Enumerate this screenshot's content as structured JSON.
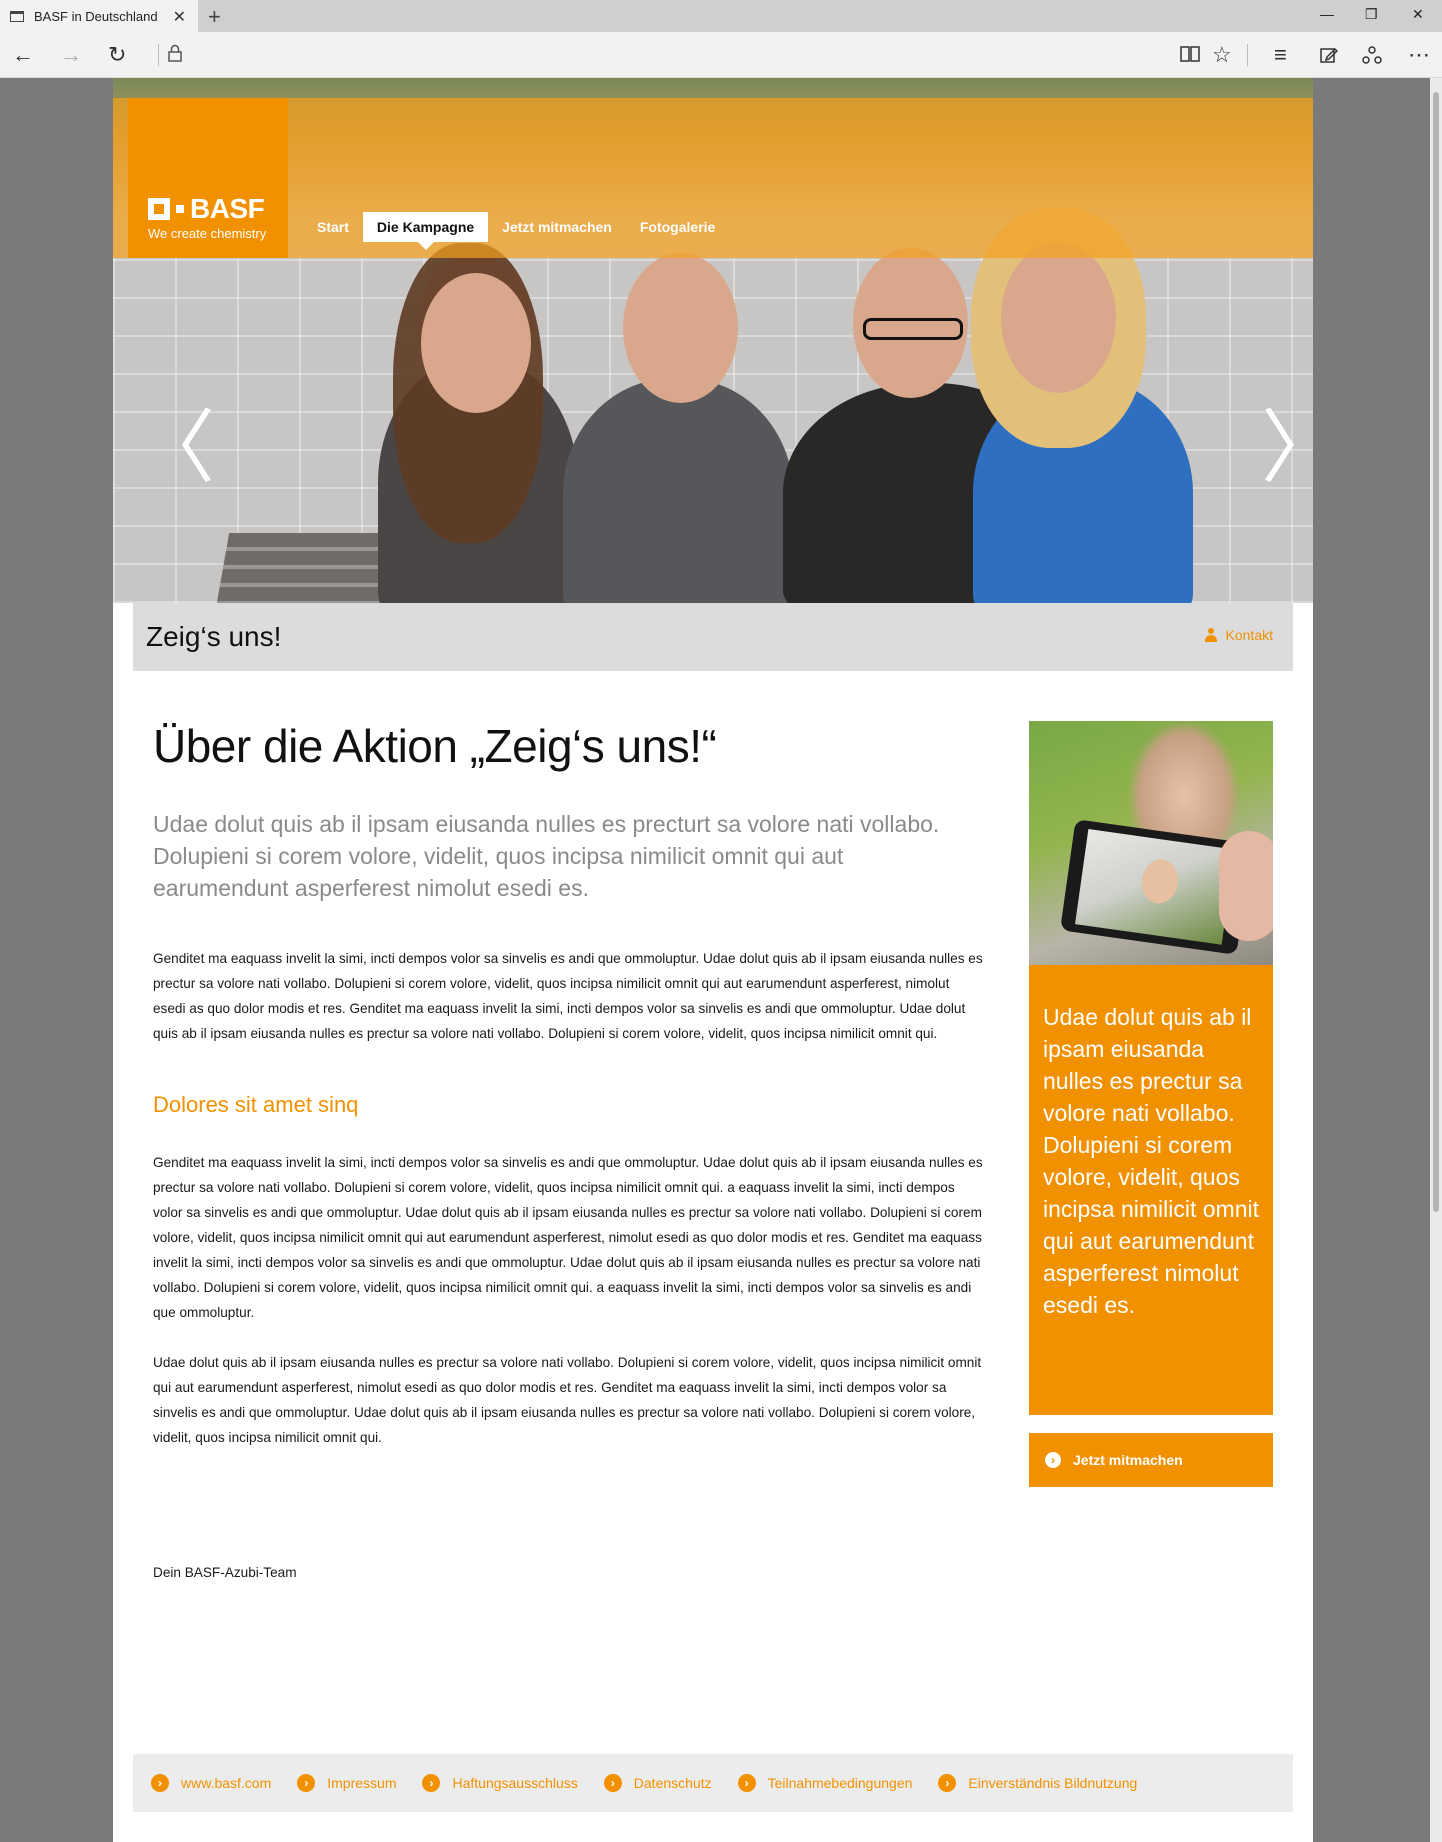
{
  "browser": {
    "tab_title": "BASF in Deutschland",
    "tab_close": "✕",
    "new_tab": "+",
    "minimize": "—",
    "restore": "❐",
    "close": "✕"
  },
  "header": {
    "logo_text": "BASF",
    "logo_tagline": "We create chemistry",
    "nav": [
      "Start",
      "Die Kampagne",
      "Jetzt mitmachen",
      "Fotogalerie"
    ],
    "active_nav": "Die Kampagne",
    "prev_arrow": "〈",
    "next_arrow": "〉"
  },
  "titlebar": {
    "title": "Zeig‘s uns!",
    "contact": "Kontakt"
  },
  "article": {
    "heading": "Über die Aktion „Zeig‘s uns!“",
    "lead": "Udae dolut quis ab il ipsam eiusanda nulles es precturt sa volore nati vollabo. Dolupieni si corem volore, videlit, quos incipsa nimilicit omnit qui aut earumendunt asperferest nimolut esedi es.",
    "para1": "Genditet ma eaquass invelit la simi, incti dempos volor sa sinvelis es andi que ommoluptur. Udae dolut quis ab il ipsam eiusanda nulles es prectur sa volore nati vollabo. Dolupieni si corem volore, videlit, quos incipsa nimilicit omnit qui aut earumendunt asperferest, nimolut esedi as quo dolor modis et res. Genditet ma eaquass invelit la simi, incti dempos volor sa sinvelis es andi que ommoluptur. Udae dolut quis ab il ipsam eiusanda nulles es prectur sa volore nati vollabo. Dolupieni si corem volore, videlit, quos incipsa nimilicit omnit qui.",
    "subheading": "Dolores sit amet sinq",
    "para2": "Genditet ma eaquass invelit la simi, incti dempos volor sa sinvelis es andi que ommoluptur. Udae dolut quis ab il ipsam eiusanda nulles es prectur sa volore nati vollabo. Dolupieni si corem volore, videlit, quos incipsa nimilicit omnit qui. a eaquass invelit la simi, incti dempos volor sa sinvelis es andi que ommoluptur. Udae dolut quis ab il ipsam eiusanda nulles es prectur sa volore nati vollabo. Dolupieni si corem volore, videlit, quos incipsa nimilicit omnit qui aut earumendunt asperferest, nimolut esedi as quo dolor modis et res. Genditet ma eaquass invelit la simi, incti dempos volor sa sinvelis es andi que ommoluptur. Udae dolut quis ab il ipsam eiusanda nulles es prectur sa volore nati vollabo. Dolupieni si corem volore, videlit, quos incipsa nimilicit omnit qui. a eaquass invelit la simi, incti dempos volor sa sinvelis es andi que ommoluptur.",
    "para3": "Udae dolut quis ab il ipsam eiusanda nulles es prectur sa volore nati vollabo. Dolupieni si corem volore, videlit, quos incipsa nimilicit omnit qui aut earumendunt asperferest, nimolut esedi as quo dolor modis et res. Genditet ma eaquass invelit la simi, incti dempos volor sa sinvelis es andi que ommoluptur. Udae dolut quis ab il ipsam eiusanda nulles es prectur sa volore nati vollabo. Dolupieni si corem volore, videlit, quos incipsa nimilicit omnit qui.",
    "signoff": "Dein BASF-Azubi-Team"
  },
  "sidebar": {
    "quote": "Udae dolut quis ab il ipsam eiusanda nulles es prectur sa volore nati vollabo. Dolupieni si corem volore, videlit, quos incipsa nimilicit omnit qui aut earumendunt asperferest nimolut esedi es.",
    "cta": "Jetzt mitmachen"
  },
  "footer": {
    "links": [
      "www.basf.com",
      "Impressum",
      "Haftungsausschluss",
      "Datenschutz",
      "Teilnahmebedingungen",
      "Einverständnis Bildnutzung"
    ]
  },
  "colors": {
    "accent": "#f29100",
    "background": "#7a7a7a"
  }
}
